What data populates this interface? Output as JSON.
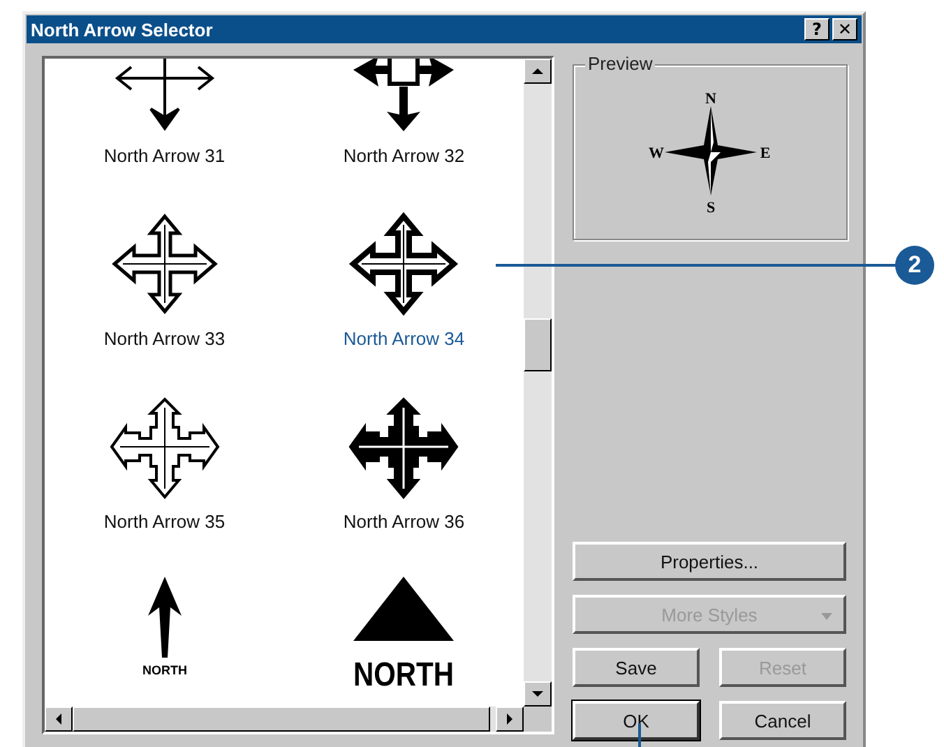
{
  "window": {
    "title": "North Arrow Selector",
    "title_buttons": [
      "?",
      "✕"
    ]
  },
  "arrows": [
    {
      "label": "North Arrow 31",
      "kind": "thin-cross",
      "selected": false
    },
    {
      "label": "North Arrow 32",
      "kind": "box-cross",
      "selected": false
    },
    {
      "label": "North Arrow 33",
      "kind": "outline-cross",
      "selected": false
    },
    {
      "label": "North Arrow 34",
      "kind": "shadow-cross",
      "selected": true
    },
    {
      "label": "North Arrow 35",
      "kind": "stepped-cross",
      "selected": false
    },
    {
      "label": "North Arrow 36",
      "kind": "solid-stepped-cross",
      "selected": false
    },
    {
      "kind": "north-arrow",
      "caption": "NORTH",
      "selected": false
    },
    {
      "kind": "north-triangle",
      "caption": "NORTH",
      "selected": false
    }
  ],
  "preview": {
    "title": "Preview",
    "letters": [
      "N",
      "E",
      "S",
      "W"
    ]
  },
  "buttons": [
    {
      "label": "Properties...",
      "kind": "wide",
      "disabled": false,
      "default": false
    },
    {
      "label": "More Styles",
      "kind": "dropdown",
      "disabled": true,
      "default": false
    },
    {
      "label": "Save",
      "kind": "push",
      "disabled": false,
      "default": false
    },
    {
      "label": "Reset",
      "kind": "push",
      "disabled": true,
      "default": false
    },
    {
      "label": "OK",
      "kind": "push",
      "disabled": false,
      "default": true
    },
    {
      "label": "Cancel",
      "kind": "push",
      "disabled": false,
      "default": false
    }
  ],
  "callout": {
    "number": "2"
  }
}
